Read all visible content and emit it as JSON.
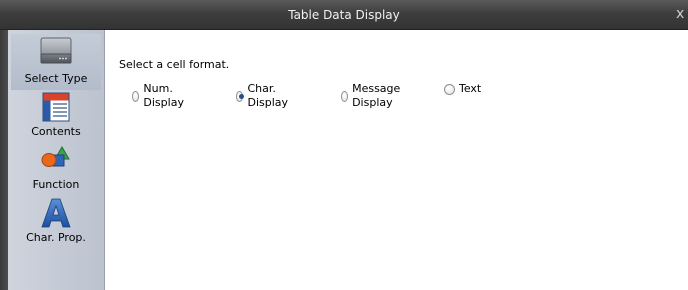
{
  "window": {
    "title": "Table Data Display",
    "close_glyph": "x"
  },
  "sidebar": {
    "items": [
      {
        "label": "Select Type",
        "icon": "drive-icon",
        "selected": true
      },
      {
        "label": "Contents",
        "icon": "table-icon",
        "selected": false
      },
      {
        "label": "Function",
        "icon": "shapes-icon",
        "selected": false
      },
      {
        "label": "Char. Prop.",
        "icon": "letter-a-icon",
        "selected": false
      }
    ]
  },
  "main": {
    "prompt": "Select a cell format.",
    "options": [
      {
        "label": "Num. Display",
        "checked": false
      },
      {
        "label": "Char. Display",
        "checked": true
      },
      {
        "label": "Message Display",
        "checked": false
      },
      {
        "label": "Text",
        "checked": false
      }
    ]
  }
}
